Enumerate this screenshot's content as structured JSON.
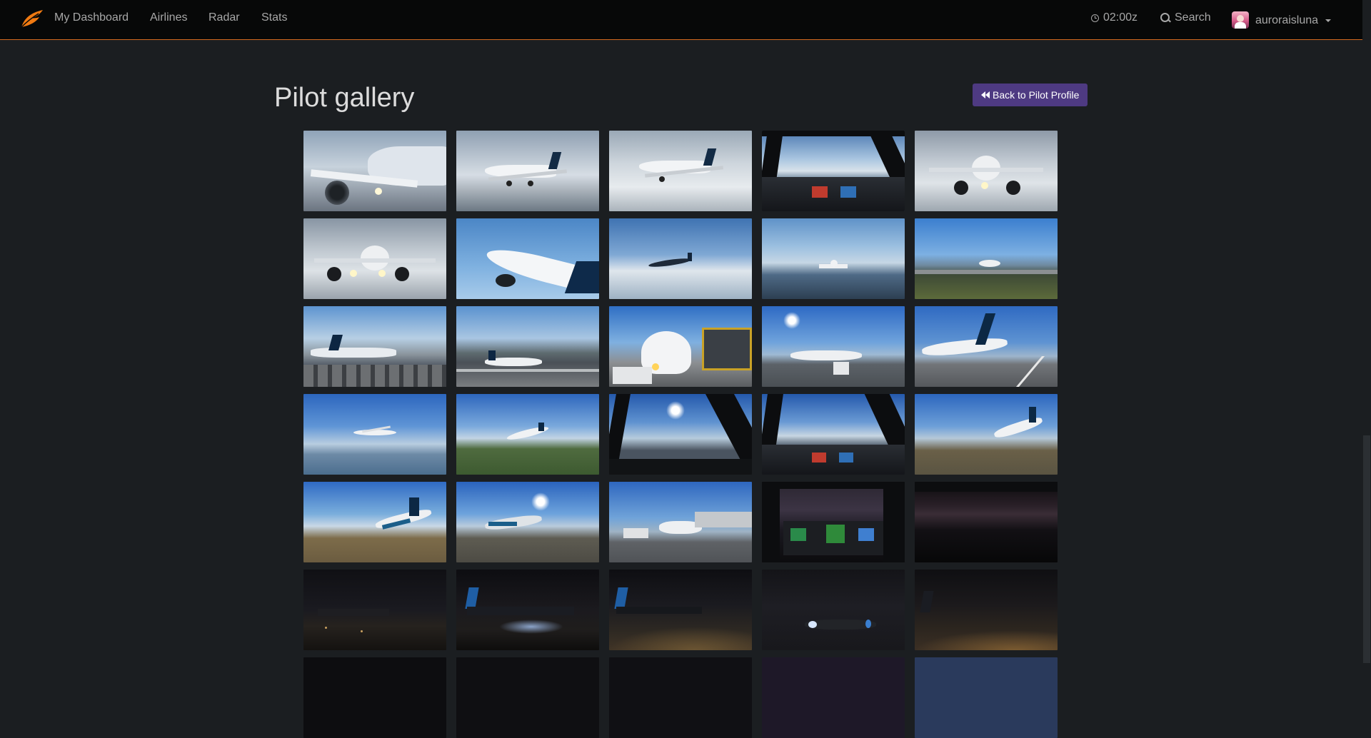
{
  "nav": {
    "brand_icon": "feather-logo-icon",
    "links": [
      {
        "label": "My Dashboard"
      },
      {
        "label": "Airlines"
      },
      {
        "label": "Radar"
      },
      {
        "label": "Stats"
      }
    ],
    "clock_text": "02:00z",
    "search_label": "Search",
    "username": "auroraisluna",
    "accent_color": "#d2691e"
  },
  "page": {
    "title": "Pilot gallery",
    "back_button_label": "Back to Pilot Profile",
    "back_button_color": "#4e3a82"
  },
  "gallery": {
    "columns": 5,
    "visible_thumbnail_rows": 6,
    "scene_tones": [
      "day-closeup",
      "day-sky",
      "day-sky",
      "cockpit-day",
      "day-front",
      "day-front",
      "day-sky",
      "day-sky",
      "day-coast",
      "day-runway",
      "day-airport",
      "day-airport",
      "day-gate",
      "day-ramp",
      "day-runway",
      "day-sky",
      "day-sky",
      "cockpit-day",
      "cockpit-day",
      "day-sky",
      "day-sky",
      "day-sky",
      "day-gate",
      "cockpit-night",
      "night-sky",
      "night-ground",
      "night-ground",
      "night-ground",
      "night-sky",
      "night-ground"
    ]
  }
}
